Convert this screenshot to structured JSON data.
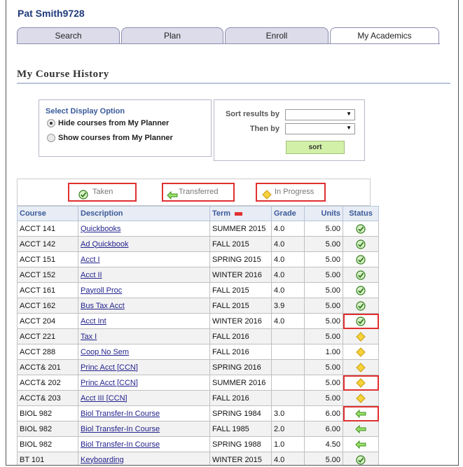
{
  "user": {
    "name": "Pat Smith9728"
  },
  "tabs": [
    {
      "label": "Search"
    },
    {
      "label": "Plan"
    },
    {
      "label": "Enroll"
    },
    {
      "label": "My Academics"
    }
  ],
  "page_title": "My Course History",
  "display_option": {
    "title": "Select Display Option",
    "options": [
      {
        "label": "Hide courses from My Planner",
        "checked": true
      },
      {
        "label": "Show courses from My Planner",
        "checked": false
      }
    ]
  },
  "sort": {
    "sort_by_label": "Sort results by",
    "then_by_label": "Then by",
    "sort_by_value": "",
    "then_by_value": "",
    "button_label": "sort"
  },
  "legend": {
    "taken": "Taken",
    "transferred": "Transferred",
    "in_progress": "In Progress"
  },
  "table": {
    "headers": [
      "Course",
      "Description",
      "Term",
      "Grade",
      "Units",
      "Status"
    ],
    "rows": [
      {
        "course": "ACCT 141",
        "description": "Quickbooks",
        "term": "SUMMER 2015",
        "grade": "4.0",
        "units": "5.00",
        "status": "taken"
      },
      {
        "course": "ACCT 142",
        "description": "Ad Quickbook",
        "term": "FALL 2015",
        "grade": "4.0",
        "units": "5.00",
        "status": "taken"
      },
      {
        "course": "ACCT 151",
        "description": "Acct I",
        "term": "SPRING 2015",
        "grade": "4.0",
        "units": "5.00",
        "status": "taken"
      },
      {
        "course": "ACCT 152",
        "description": "Acct II",
        "term": "WINTER 2016",
        "grade": "4.0",
        "units": "5.00",
        "status": "taken"
      },
      {
        "course": "ACCT 161",
        "description": "Payroll Proc",
        "term": "FALL 2015",
        "grade": "4.0",
        "units": "5.00",
        "status": "taken"
      },
      {
        "course": "ACCT 162",
        "description": "Bus Tax Acct",
        "term": "FALL 2015",
        "grade": "3.9",
        "units": "5.00",
        "status": "taken"
      },
      {
        "course": "ACCT 204",
        "description": "Acct Int",
        "term": "WINTER 2016",
        "grade": "4.0",
        "units": "5.00",
        "status": "taken"
      },
      {
        "course": "ACCT 221",
        "description": "Tax I",
        "term": "FALL 2016",
        "grade": "",
        "units": "5.00",
        "status": "in_progress"
      },
      {
        "course": "ACCT 288",
        "description": "Coop No Sem",
        "term": "FALL 2016",
        "grade": "",
        "units": "1.00",
        "status": "in_progress"
      },
      {
        "course": "ACCT& 201",
        "description": "Princ Acct [CCN]",
        "term": "SPRING 2016",
        "grade": "",
        "units": "5.00",
        "status": "in_progress"
      },
      {
        "course": "ACCT& 202",
        "description": "Princ Acct [CCN]",
        "term": "SUMMER 2016",
        "grade": "",
        "units": "5.00",
        "status": "in_progress"
      },
      {
        "course": "ACCT& 203",
        "description": "Acct III [CCN]",
        "term": "FALL 2016",
        "grade": "",
        "units": "5.00",
        "status": "in_progress"
      },
      {
        "course": "BIOL 982",
        "description": "Biol Transfer-In Course",
        "term": "SPRING 1984",
        "grade": "3.0",
        "units": "6.00",
        "status": "transferred"
      },
      {
        "course": "BIOL 982",
        "description": "Biol Transfer-In Course",
        "term": "FALL 1985",
        "grade": "2.0",
        "units": "6.00",
        "status": "transferred"
      },
      {
        "course": "BIOL 982",
        "description": "Biol Transfer-In Course",
        "term": "SPRING 1988",
        "grade": "1.0",
        "units": "4.50",
        "status": "transferred"
      },
      {
        "course": "BT 101",
        "description": "Keyboarding",
        "term": "WINTER 2015",
        "grade": "4.0",
        "units": "5.00",
        "status": "taken"
      }
    ]
  },
  "colors": {
    "taken": "#4caf1a",
    "in_progress": "#f0c020",
    "transferred": "#66bb33",
    "highlight": "#e03030"
  }
}
